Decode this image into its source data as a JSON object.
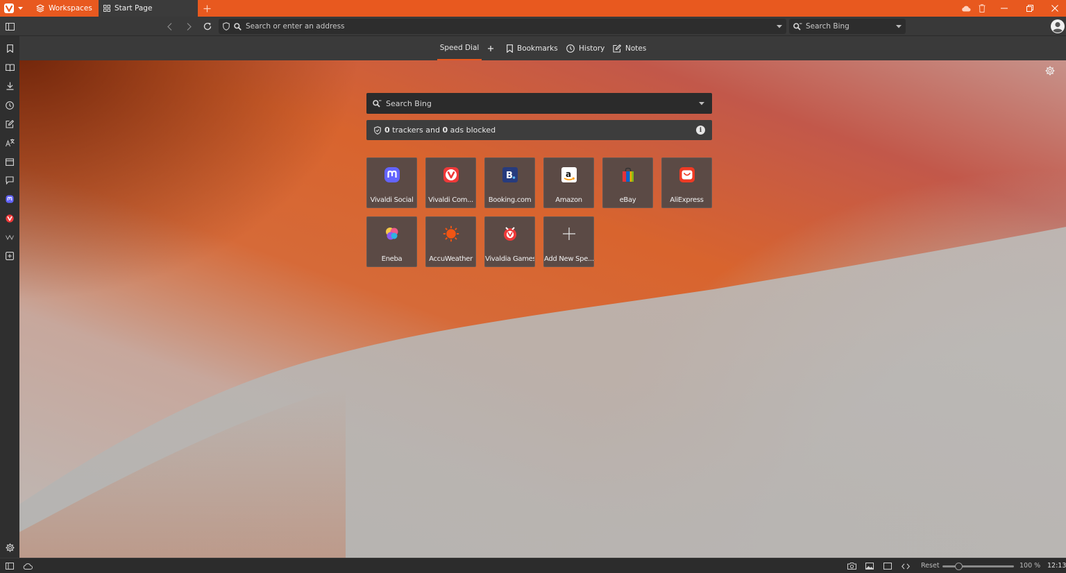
{
  "colors": {
    "accent": "#e8591f",
    "tile_bg": "#5b4a45"
  },
  "tabbar": {
    "workspaces_label": "Workspaces",
    "tabs": [
      {
        "title": "Start Page",
        "icon": "speed-dial-grid-icon",
        "active": true
      }
    ]
  },
  "addressbar": {
    "url_placeholder": "Search or enter an address",
    "search_placeholder": "Search Bing"
  },
  "startpage_nav": [
    {
      "label": "Speed Dial",
      "icon": "none"
    },
    {
      "label": "Bookmarks",
      "icon": "bookmark-icon"
    },
    {
      "label": "History",
      "icon": "clock-icon"
    },
    {
      "label": "Notes",
      "icon": "note-edit-icon"
    }
  ],
  "speed_dial": {
    "search_placeholder": "Search Bing",
    "blocker": {
      "trackers": "0",
      "trackers_text": "trackers and",
      "ads": "0",
      "ads_text": "ads blocked"
    },
    "tiles": [
      {
        "label": "Vivaldi Social",
        "icon": "mastodon-icon"
      },
      {
        "label": "Vivaldi Com...",
        "icon": "vivaldi-icon"
      },
      {
        "label": "Booking.com",
        "icon": "booking-icon"
      },
      {
        "label": "Amazon",
        "icon": "amazon-icon"
      },
      {
        "label": "eBay",
        "icon": "ebay-bag-icon"
      },
      {
        "label": "AliExpress",
        "icon": "aliexpress-icon"
      },
      {
        "label": "Eneba",
        "icon": "eneba-icon"
      },
      {
        "label": "AccuWeather",
        "icon": "accuweather-sun-icon"
      },
      {
        "label": "Vivaldia Games",
        "icon": "vivaldia-games-icon"
      },
      {
        "label": "Add New Spe...",
        "icon": "plus-icon"
      }
    ]
  },
  "statusbar": {
    "reset_label": "Reset",
    "zoom": "100 %",
    "zoom_fraction": 0.2,
    "clock": "12:13"
  }
}
